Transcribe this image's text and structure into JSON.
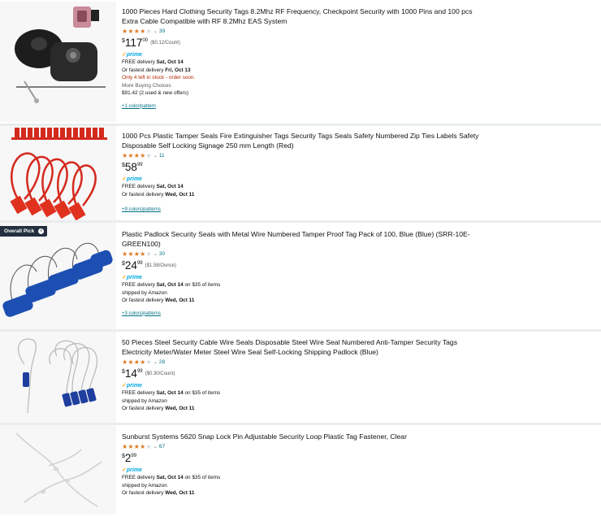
{
  "colors": {
    "link": "#007185",
    "star": "#de7921",
    "prime_blue": "#00a8e1",
    "prime_check": "#ffa41c",
    "stock_red": "#b12704",
    "badge_bg": "#232f3e"
  },
  "results": [
    {
      "title": "1000 Pieces Hard Clothing Security Tags 8.2Mhz RF Frequency, Checkpoint Security with 1000 Pins and 100 pcs Extra Cable Compatible with RF 8.2Mhz EAS System",
      "rating": 4.5,
      "reviews": "39",
      "currency": "$",
      "price_whole": "117",
      "price_fraction": "00",
      "unit_price": "($0.12/Count)",
      "prime": "prime",
      "delivery_prefix": "FREE delivery ",
      "delivery_date": "Sat, Oct 14",
      "delivery_suffix": "",
      "shipped_by": "",
      "fastest_prefix": "Or fastest delivery ",
      "fastest_date": "Fri, Oct 13",
      "stock": "Only 4 left in stock - order soon.",
      "more_buying": "More Buying Choices",
      "more_offers": "$91.42 (2 used & new offers)",
      "variants_link": "+1 color/pattern",
      "image_icon": "security-tag-kit-icon"
    },
    {
      "title": "1000 Pcs Plastic Tamper Seals Fire Extinguisher Tags Security Tags Seals Safety Numbered Zip Ties Labels Safety Disposable Self Locking Signage 250 mm Length (Red)",
      "rating": 4.5,
      "reviews": "11",
      "currency": "$",
      "price_whole": "58",
      "price_fraction": "99",
      "unit_price": "",
      "prime": "prime",
      "delivery_prefix": "FREE delivery ",
      "delivery_date": "Sat, Oct 14",
      "delivery_suffix": "",
      "shipped_by": "",
      "fastest_prefix": "Or fastest delivery ",
      "fastest_date": "Wed, Oct 11",
      "stock": "",
      "more_buying": "",
      "more_offers": "",
      "variants_link": "+9 colors/patterns",
      "image_icon": "red-tamper-seal-icon"
    },
    {
      "badge": "Overall Pick",
      "title": "Plastic Padlock Security Seals with Metal Wire Numbered Tamper Proof Tag Pack of 100, Blue (Blue) (SRR-10E-GREEN100)",
      "rating": 4.0,
      "reviews": "30",
      "currency": "$",
      "price_whole": "24",
      "price_fraction": "99",
      "unit_price": "($1.58/Ounce)",
      "prime": "prime",
      "delivery_prefix": "FREE delivery ",
      "delivery_date": "Sat, Oct 14",
      "delivery_suffix": " on $35 of items",
      "shipped_by": "shipped by Amazon",
      "fastest_prefix": "Or fastest delivery ",
      "fastest_date": "Wed, Oct 11",
      "stock": "",
      "more_buying": "",
      "more_offers": "",
      "variants_link": "+3 colors/patterns",
      "image_icon": "blue-padlock-seal-icon"
    },
    {
      "title": "50 Pieces Steel Security Cable Wire Seals Disposable Steel Wire Seal Numbered Anti-Tamper Security Tags Electricity Meter/Water Meter Steel Wire Seal Self-Locking Shipping Padlock (Blue)",
      "rating": 4.5,
      "reviews": "28",
      "currency": "$",
      "price_whole": "14",
      "price_fraction": "99",
      "unit_price": "($0.30/Count)",
      "prime": "prime",
      "delivery_prefix": "FREE delivery ",
      "delivery_date": "Sat, Oct 14",
      "delivery_suffix": " on $35 of items",
      "shipped_by": "shipped by Amazon",
      "fastest_prefix": "Or fastest delivery ",
      "fastest_date": "Wed, Oct 11",
      "stock": "",
      "more_buying": "",
      "more_offers": "",
      "variants_link": "",
      "image_icon": "steel-wire-seal-icon"
    },
    {
      "title": "Sunburst Systems 5620 Snap Lock Pin Adjustable Security Loop Plastic Tag Fastener, Clear",
      "rating": 4.5,
      "reviews": "67",
      "currency": "$",
      "price_whole": "2",
      "price_fraction": "99",
      "unit_price": "",
      "prime": "prime",
      "delivery_prefix": "FREE delivery ",
      "delivery_date": "Sat, Oct 14",
      "delivery_suffix": " on $35 of items",
      "shipped_by": "shipped by Amazon",
      "fastest_prefix": "Or fastest delivery ",
      "fastest_date": "Wed, Oct 11",
      "stock": "",
      "more_buying": "",
      "more_offers": "",
      "variants_link": "",
      "image_icon": "clear-loop-fastener-icon"
    }
  ]
}
